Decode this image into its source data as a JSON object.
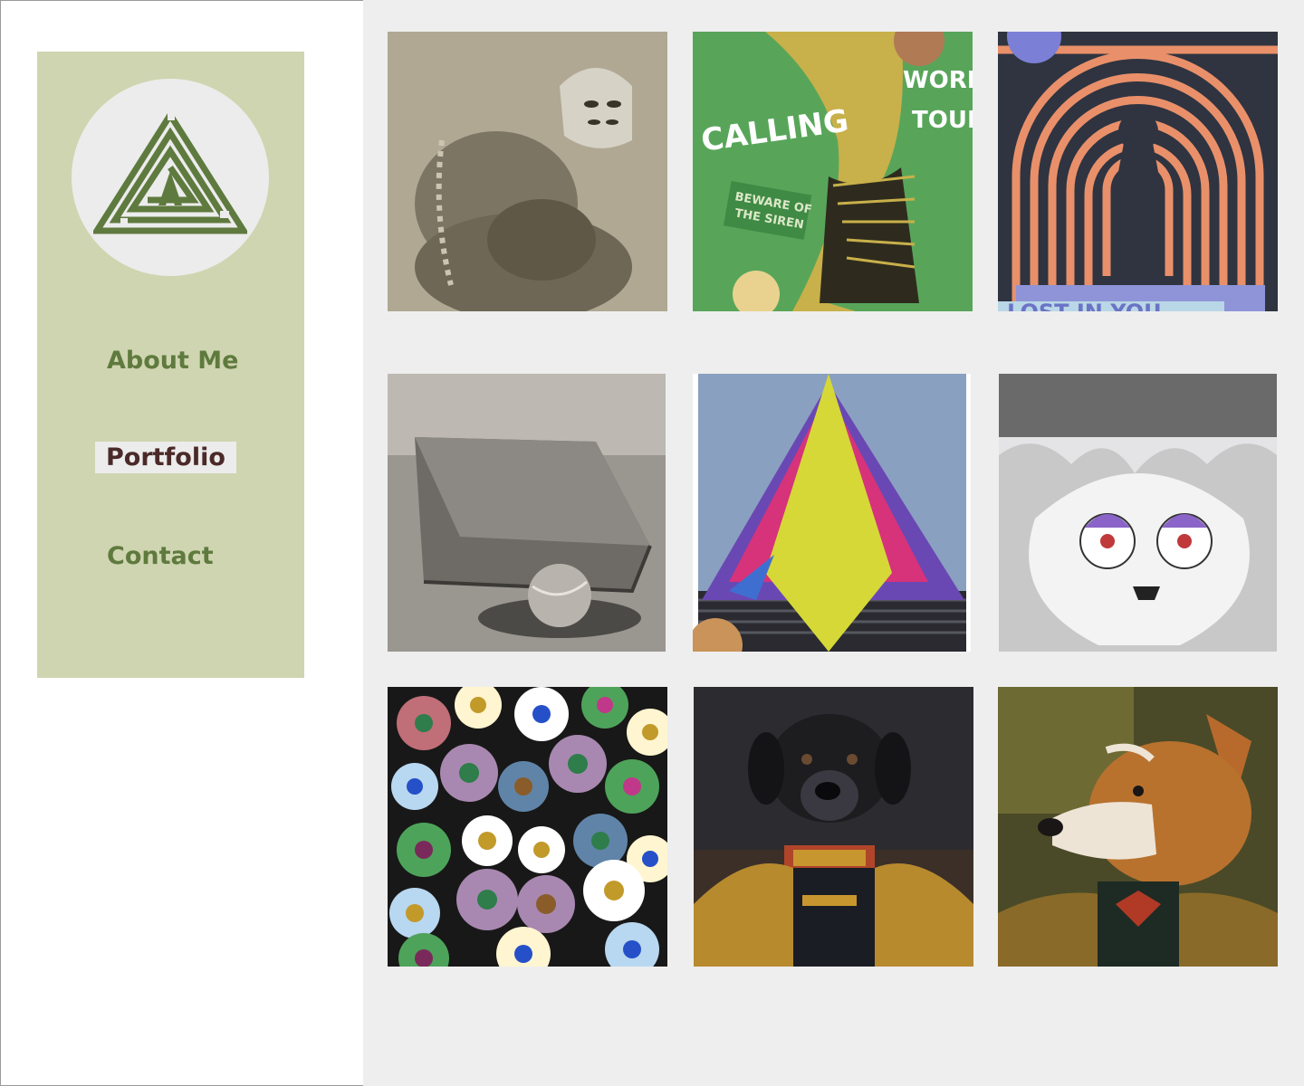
{
  "nav": {
    "items": [
      {
        "label": "About Me",
        "active": false
      },
      {
        "label": "Portfolio",
        "active": true
      },
      {
        "label": "Contact",
        "active": false
      }
    ]
  },
  "colors": {
    "sidebar_bg": "#cfd5b0",
    "nav_text": "#5f7a3e",
    "nav_active_text": "#4a2a28",
    "gallery_bg": "#eeeeee"
  },
  "gallery": {
    "tiles": [
      {
        "subject": "masked figure sculpture drawing"
      },
      {
        "subject": "siren tail poster",
        "text": [
          "CALLING",
          "WORLD",
          "TOUR",
          "BEWARE OF",
          "THE SIREN"
        ]
      },
      {
        "subject": "keyhole maze poster",
        "text": [
          "LOST IN YOU"
        ]
      },
      {
        "subject": "charcoal bag and tennis ball drawing"
      },
      {
        "subject": "colorful scribbled tree"
      },
      {
        "subject": "fluffy creature with spiral eyes"
      },
      {
        "subject": "daisy flower pattern"
      },
      {
        "subject": "dog in military uniform portrait"
      },
      {
        "subject": "corgi in military uniform portrait"
      }
    ]
  }
}
